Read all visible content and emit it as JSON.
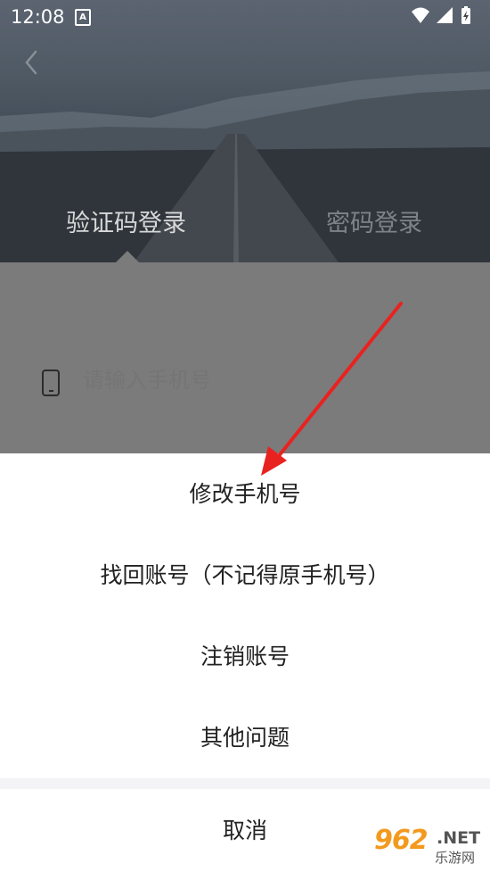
{
  "status_bar": {
    "time": "12:08",
    "notification_icon": "A"
  },
  "tabs": {
    "code_login": "验证码登录",
    "password_login": "密码登录"
  },
  "phone_field": {
    "placeholder": "请输入手机号"
  },
  "sheet": {
    "options": [
      "修改手机号",
      "找回账号（不记得原手机号）",
      "注销账号",
      "其他问题"
    ],
    "cancel": "取消"
  },
  "watermark": {
    "number": "962",
    "domain": ".NET",
    "name": "乐游网"
  },
  "colors": {
    "annotation_arrow": "#e8231f",
    "overlay": "#7b7b7b",
    "watermark": "#f39a1e"
  }
}
